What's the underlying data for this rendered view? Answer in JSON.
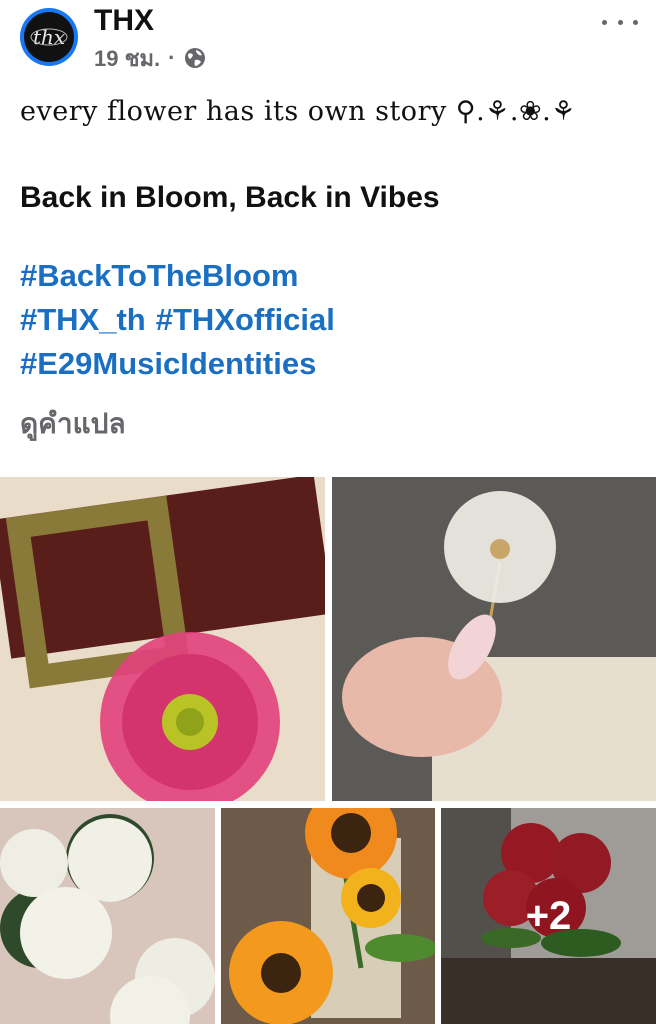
{
  "post": {
    "page_name": "THX",
    "avatar_text": "thx",
    "time": "19 ชม.",
    "separator": "·",
    "audience_icon": "globe-icon",
    "more_icon": "more-dots-icon"
  },
  "caption": {
    "line1": "every flower has its own story ⚲.⚘.❀.⚘",
    "line2": "Back in Bloom, Back in Vibes"
  },
  "hashtags": {
    "line1": [
      "#BackToTheBloom"
    ],
    "line2": [
      "#THX_th",
      "#THXofficial"
    ],
    "line3": [
      "#E29MusicIdentities"
    ]
  },
  "see_translation": "ดูคำแปล",
  "gallery": {
    "photos": [
      {
        "subject": "pink gerbera on brown belt"
      },
      {
        "subject": "hand holding dandelion"
      },
      {
        "subject": "white roses bouquet"
      },
      {
        "subject": "sunflowers"
      },
      {
        "subject": "red carnations"
      }
    ],
    "more_count_label": "+2"
  },
  "colors": {
    "link_blue": "#1a6fc2",
    "meta_gray": "#65676b",
    "avatar_ring": "#1877f2"
  }
}
